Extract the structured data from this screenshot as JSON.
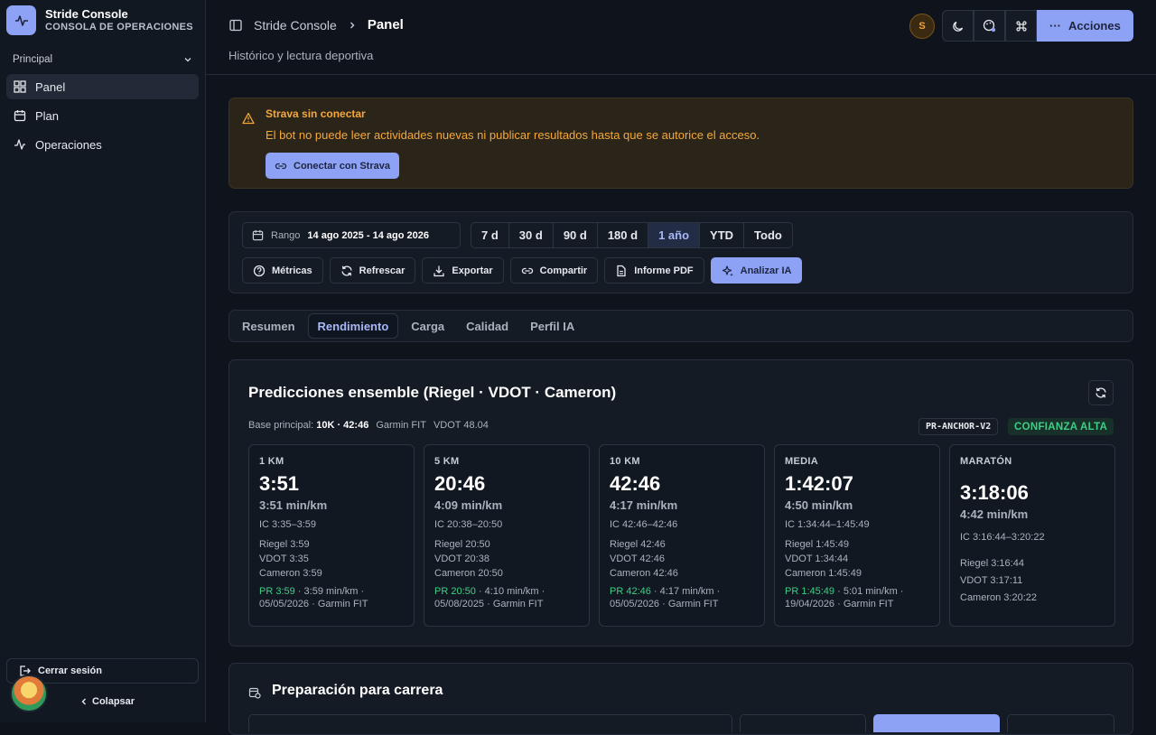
{
  "brand": {
    "title": "Stride Console",
    "subtitle": "CONSOLA DE OPERACIONES"
  },
  "sidebar": {
    "section": "Principal",
    "items": [
      {
        "label": "Panel",
        "icon": "grid-icon",
        "active": true
      },
      {
        "label": "Plan",
        "icon": "calendar-icon",
        "active": false
      },
      {
        "label": "Operaciones",
        "icon": "activity-icon",
        "active": false
      }
    ],
    "logout": "Cerrar sesión",
    "collapse": "Colapsar"
  },
  "header": {
    "crumb_root": "Stride Console",
    "crumb_current": "Panel",
    "subtitle": "Histórico y lectura deportiva",
    "user_initial": "S",
    "actions_label": "Acciones"
  },
  "alert": {
    "title": "Strava sin conectar",
    "body": "El bot no puede leer actividades nuevas ni publicar resultados hasta que se autorice el acceso.",
    "button": "Conectar con Strava"
  },
  "filters": {
    "range_label": "Rango",
    "range_value": "14 ago 2025 - 14 ago 2026",
    "periods": [
      "7 d",
      "30 d",
      "90 d",
      "180 d",
      "1 año",
      "YTD",
      "Todo"
    ],
    "active_period": "1 año",
    "actions": [
      "Métricas",
      "Refrescar",
      "Exportar",
      "Compartir",
      "Informe PDF",
      "Analizar IA"
    ]
  },
  "tabs": {
    "items": [
      "Resumen",
      "Rendimiento",
      "Carga",
      "Calidad",
      "Perfil IA"
    ],
    "active": "Rendimiento"
  },
  "predictions": {
    "title": "Predicciones ensemble (Riegel · VDOT · Cameron)",
    "base_label": "Base principal:",
    "base_value": "10K · 42:46",
    "base_source": "Garmin FIT",
    "base_vdot": "VDOT 48.04",
    "anchor_tag": "PR-ANCHOR-V2",
    "confidence": "CONFIANZA ALTA",
    "cards": [
      {
        "label": "1 KM",
        "time": "3:51",
        "pace": "3:51 min/km",
        "ic": "IC 3:35–3:59",
        "riegel": "Riegel 3:59",
        "vdot": "VDOT 3:35",
        "cameron": "Cameron 3:59",
        "pr": "PR 3:59",
        "pr_rest": " · 3:59 min/km ·",
        "pr_date": "05/05/2026 · Garmin FIT"
      },
      {
        "label": "5 KM",
        "time": "20:46",
        "pace": "4:09 min/km",
        "ic": "IC 20:38–20:50",
        "riegel": "Riegel 20:50",
        "vdot": "VDOT 20:38",
        "cameron": "Cameron 20:50",
        "pr": "PR 20:50",
        "pr_rest": " · 4:10 min/km ·",
        "pr_date": "05/08/2025 · Garmin FIT"
      },
      {
        "label": "10 KM",
        "time": "42:46",
        "pace": "4:17 min/km",
        "ic": "IC 42:46–42:46",
        "riegel": "Riegel 42:46",
        "vdot": "VDOT 42:46",
        "cameron": "Cameron 42:46",
        "pr": "PR 42:46",
        "pr_rest": " · 4:17 min/km ·",
        "pr_date": "05/05/2026 · Garmin FIT"
      },
      {
        "label": "MEDIA",
        "time": "1:42:07",
        "pace": "4:50 min/km",
        "ic": "IC 1:34:44–1:45:49",
        "riegel": "Riegel 1:45:49",
        "vdot": "VDOT 1:34:44",
        "cameron": "Cameron 1:45:49",
        "pr": "PR 1:45:49",
        "pr_rest": " · 5:01 min/km ·",
        "pr_date": "19/04/2026 · Garmin FIT"
      },
      {
        "label": "MARATÓN",
        "time": "3:18:06",
        "pace": "4:42 min/km",
        "ic": "IC 3:16:44–3:20:22",
        "riegel": "Riegel 3:16:44",
        "vdot": "VDOT 3:17:11",
        "cameron": "Cameron 3:20:22"
      }
    ]
  },
  "race_prep": {
    "title": "Preparación para carrera"
  },
  "colors": {
    "accent": "#8ea2f5",
    "warning": "#f5a83a",
    "success": "#3ecf84",
    "bg": "#0f141c"
  }
}
